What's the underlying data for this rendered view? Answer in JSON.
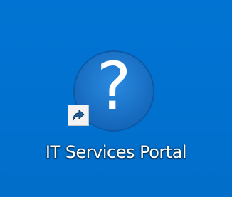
{
  "desktop": {
    "background_color": "#0172d0",
    "shortcut": {
      "icon": "help-question-icon",
      "icon_glyph": "?",
      "overlay": "shortcut-arrow-icon",
      "label": "IT Services Portal"
    }
  }
}
